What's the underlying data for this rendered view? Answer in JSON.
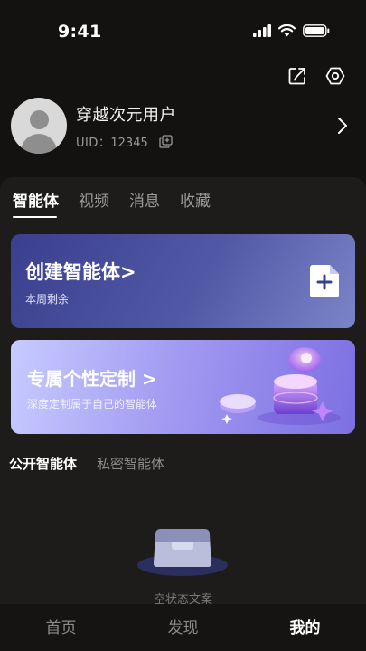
{
  "status_bar": {
    "time": "9:41"
  },
  "icons": {
    "share": "share-icon",
    "settings": "settings-icon",
    "copy": "copy-icon",
    "chevron": "chevron-right-icon",
    "doc": "document-add-icon"
  },
  "profile": {
    "username": "穿越次元用户",
    "uid_label": "UID：",
    "uid_value": "12345"
  },
  "tabs": [
    {
      "label": "智能体",
      "active": true
    },
    {
      "label": "视频",
      "active": false
    },
    {
      "label": "消息",
      "active": false
    },
    {
      "label": "收藏",
      "active": false
    }
  ],
  "create_card": {
    "title": "创建智能体>",
    "subtitle": "本周剩余"
  },
  "custom_card": {
    "title": "专属个性定制 >",
    "subtitle": "深度定制属于自己的智能体"
  },
  "subtabs": [
    {
      "label": "公开智能体",
      "active": true
    },
    {
      "label": "私密智能体",
      "active": false
    }
  ],
  "empty_state": {
    "label": "空状态文案"
  },
  "bottom_nav": [
    {
      "label": "首页",
      "active": false
    },
    {
      "label": "发现",
      "active": false
    },
    {
      "label": "我的",
      "active": true
    }
  ],
  "colors": {
    "background": "#141211",
    "panel": "#1e1c1b",
    "create_card_from": "#3a3f8e",
    "create_card_to": "#7c84c8",
    "custom_card_from": "#c7cbff",
    "custom_card_to": "#7d6fe2"
  }
}
